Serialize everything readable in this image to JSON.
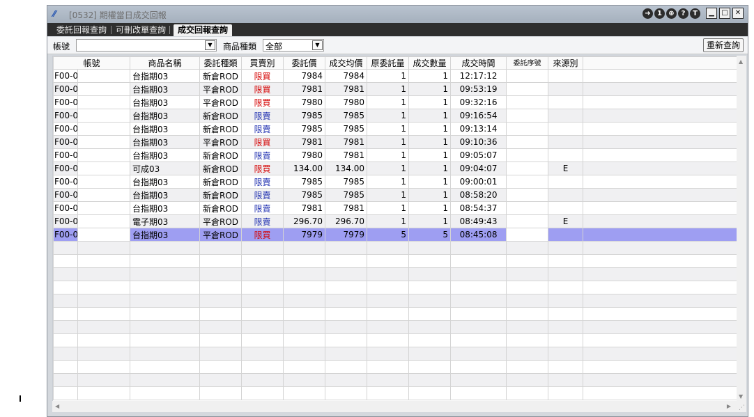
{
  "window": {
    "title": "[0532] 期權當日成交回報",
    "icon": "app-logo-icon",
    "controls": [
      "exit-icon",
      "1",
      "link-icon",
      "?",
      "T",
      "minimize-icon",
      "restore-icon",
      "close-icon"
    ]
  },
  "tabs": [
    {
      "label": "委託回報查詢",
      "active": false
    },
    {
      "label": "可刪改單查詢",
      "active": false
    },
    {
      "label": "成交回報查詢",
      "active": true
    }
  ],
  "filters": {
    "account_label": "帳號",
    "account_value": "",
    "product_type_label": "商品種類",
    "product_type_value": "全部",
    "refresh_label": "重新查詢"
  },
  "columns": [
    "帳號",
    "",
    "商品名稱",
    "委託種類",
    "買賣別",
    "委託價",
    "成交均價",
    "原委託量",
    "成交數量",
    "成交時間",
    "委託序號",
    "來源別",
    ""
  ],
  "rows": [
    {
      "acct": "F00-0",
      "product": "台指期03",
      "order_type": "新倉ROD",
      "side": "限買",
      "side_kind": "buy",
      "price": "7984",
      "avg_price": "7984",
      "orig_qty": "1",
      "fill_qty": "1",
      "time": "12:17:12",
      "source": ""
    },
    {
      "acct": "F00-0",
      "product": "台指期03",
      "order_type": "平倉ROD",
      "side": "限買",
      "side_kind": "buy",
      "price": "7981",
      "avg_price": "7981",
      "orig_qty": "1",
      "fill_qty": "1",
      "time": "09:53:19",
      "source": ""
    },
    {
      "acct": "F00-0",
      "product": "台指期03",
      "order_type": "平倉ROD",
      "side": "限買",
      "side_kind": "buy",
      "price": "7980",
      "avg_price": "7980",
      "orig_qty": "1",
      "fill_qty": "1",
      "time": "09:32:16",
      "source": ""
    },
    {
      "acct": "F00-0",
      "product": "台指期03",
      "order_type": "新倉ROD",
      "side": "限賣",
      "side_kind": "sell",
      "price": "7985",
      "avg_price": "7985",
      "orig_qty": "1",
      "fill_qty": "1",
      "time": "09:16:54",
      "source": ""
    },
    {
      "acct": "F00-0",
      "product": "台指期03",
      "order_type": "新倉ROD",
      "side": "限賣",
      "side_kind": "sell",
      "price": "7985",
      "avg_price": "7985",
      "orig_qty": "1",
      "fill_qty": "1",
      "time": "09:13:14",
      "source": ""
    },
    {
      "acct": "F00-0",
      "product": "台指期03",
      "order_type": "平倉ROD",
      "side": "限買",
      "side_kind": "buy",
      "price": "7981",
      "avg_price": "7981",
      "orig_qty": "1",
      "fill_qty": "1",
      "time": "09:10:36",
      "source": ""
    },
    {
      "acct": "F00-0",
      "product": "台指期03",
      "order_type": "新倉ROD",
      "side": "限賣",
      "side_kind": "sell",
      "price": "7980",
      "avg_price": "7981",
      "orig_qty": "1",
      "fill_qty": "1",
      "time": "09:05:07",
      "source": ""
    },
    {
      "acct": "F00-0",
      "product": "可成03",
      "order_type": "新倉ROD",
      "side": "限買",
      "side_kind": "buy",
      "price": "134.00",
      "avg_price": "134.00",
      "orig_qty": "1",
      "fill_qty": "1",
      "time": "09:04:07",
      "source": "E"
    },
    {
      "acct": "F00-0",
      "product": "台指期03",
      "order_type": "新倉ROD",
      "side": "限賣",
      "side_kind": "sell",
      "price": "7985",
      "avg_price": "7985",
      "orig_qty": "1",
      "fill_qty": "1",
      "time": "09:00:01",
      "source": ""
    },
    {
      "acct": "F00-0",
      "product": "台指期03",
      "order_type": "新倉ROD",
      "side": "限賣",
      "side_kind": "sell",
      "price": "7985",
      "avg_price": "7985",
      "orig_qty": "1",
      "fill_qty": "1",
      "time": "08:58:20",
      "source": ""
    },
    {
      "acct": "F00-0",
      "product": "台指期03",
      "order_type": "新倉ROD",
      "side": "限賣",
      "side_kind": "sell",
      "price": "7981",
      "avg_price": "7981",
      "orig_qty": "1",
      "fill_qty": "1",
      "time": "08:54:37",
      "source": ""
    },
    {
      "acct": "F00-0",
      "product": "電子期03",
      "order_type": "平倉ROD",
      "side": "限賣",
      "side_kind": "sell",
      "price": "296.70",
      "avg_price": "296.70",
      "orig_qty": "1",
      "fill_qty": "1",
      "time": "08:49:43",
      "source": "E"
    },
    {
      "acct": "F00-0",
      "product": "台指期03",
      "order_type": "平倉ROD",
      "side": "限買",
      "side_kind": "buy",
      "price": "7979",
      "avg_price": "7979",
      "orig_qty": "5",
      "fill_qty": "5",
      "time": "08:45:08",
      "source": "",
      "selected": true
    }
  ],
  "empty_rows": 12,
  "colors": {
    "buy": "#d40000",
    "sell": "#2030b0",
    "selected_row": "#9e9ef2",
    "tab_bar": "#2e2e2e"
  }
}
